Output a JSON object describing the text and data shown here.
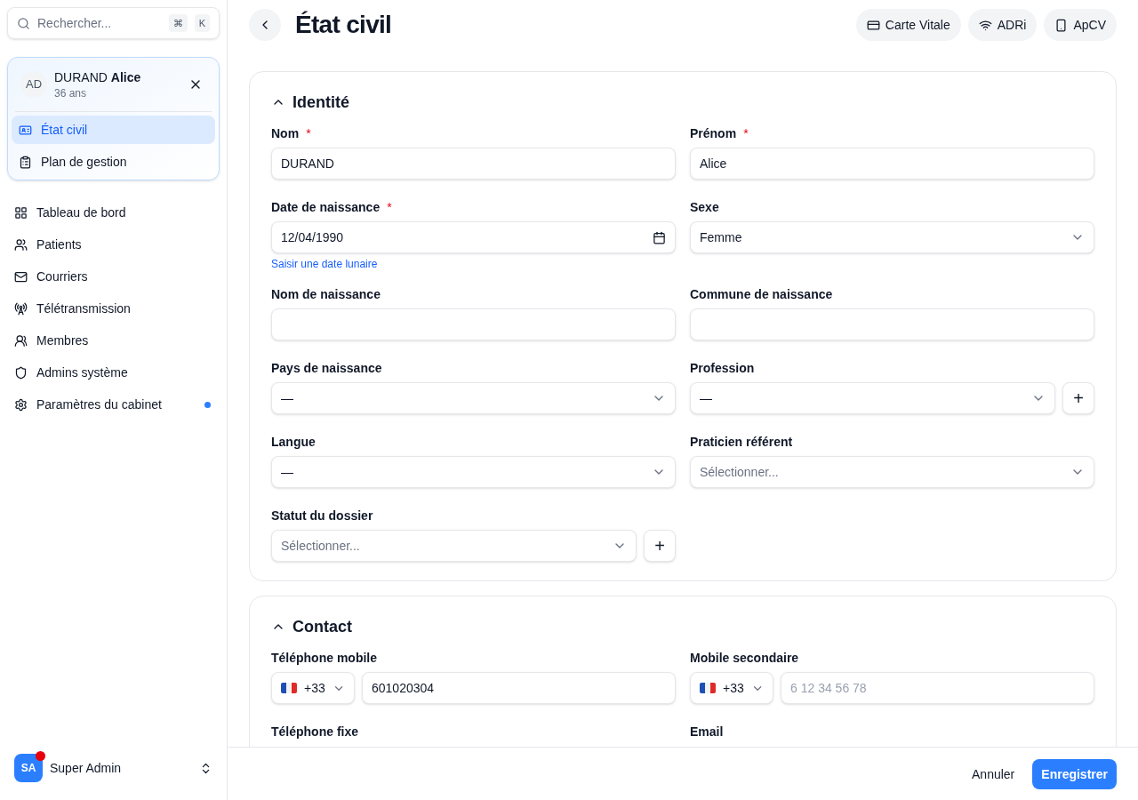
{
  "search": {
    "placeholder": "Rechercher...",
    "keys": [
      "⌘",
      "K"
    ]
  },
  "patient": {
    "initials": "AD",
    "last_name": "DURAND",
    "first_name": "Alice",
    "age": "36 ans",
    "items": [
      {
        "label": "État civil",
        "selected": true
      },
      {
        "label": "Plan de gestion",
        "selected": false
      }
    ]
  },
  "nav": [
    {
      "label": "Tableau de bord",
      "notification": false
    },
    {
      "label": "Patients",
      "notification": false
    },
    {
      "label": "Courriers",
      "notification": false
    },
    {
      "label": "Télétransmission",
      "notification": false
    },
    {
      "label": "Membres",
      "notification": false
    },
    {
      "label": "Admins système",
      "notification": false
    },
    {
      "label": "Paramètres du cabinet",
      "notification": true
    }
  ],
  "user": {
    "initials": "SA",
    "name": "Super Admin",
    "notification": true
  },
  "header": {
    "title": "État civil",
    "buttons": [
      "Carte Vitale",
      "ADRi",
      "ApCV"
    ]
  },
  "sections": [
    {
      "title": "Identité",
      "expanded": true,
      "fields": [
        {
          "kind": "text",
          "label": "Nom",
          "required": true,
          "value": "DURAND"
        },
        {
          "kind": "text",
          "label": "Prénom",
          "required": true,
          "value": "Alice"
        },
        {
          "kind": "date",
          "label": "Date de naissance",
          "required": true,
          "value": "12/04/1990",
          "link": "Saisir une date lunaire"
        },
        {
          "kind": "select",
          "label": "Sexe",
          "required": false,
          "value": "Femme"
        },
        {
          "kind": "text",
          "label": "Nom de naissance",
          "required": false
        },
        {
          "kind": "text",
          "label": "Commune de naissance",
          "required": false
        },
        {
          "kind": "select",
          "label": "Pays de naissance",
          "required": false,
          "value": "—"
        },
        {
          "kind": "select",
          "label": "Profession",
          "required": false,
          "value": "—",
          "add": "+"
        },
        {
          "kind": "select",
          "label": "Langue",
          "required": false,
          "value": "—"
        },
        {
          "kind": "select",
          "label": "Praticien référent",
          "required": false,
          "placeholder": "Sélectionner..."
        },
        {
          "kind": "select",
          "label": "Statut du dossier",
          "required": false,
          "placeholder": "Sélectionner...",
          "add": "+"
        }
      ]
    },
    {
      "title": "Contact",
      "expanded": true,
      "fields": [
        {
          "kind": "phone",
          "label": "Téléphone mobile",
          "required": false,
          "code": "+33",
          "value": "601020304"
        },
        {
          "kind": "phone",
          "label": "Mobile secondaire",
          "required": false,
          "code": "+33",
          "placeholder": "6 12 34 56 78"
        },
        {
          "kind": "label",
          "label": "Téléphone fixe",
          "required": false
        },
        {
          "kind": "label",
          "label": "Email",
          "required": false
        }
      ]
    }
  ],
  "required_mark": "*",
  "footer": {
    "cancel": "Annuler",
    "save": "Enregistrer"
  }
}
